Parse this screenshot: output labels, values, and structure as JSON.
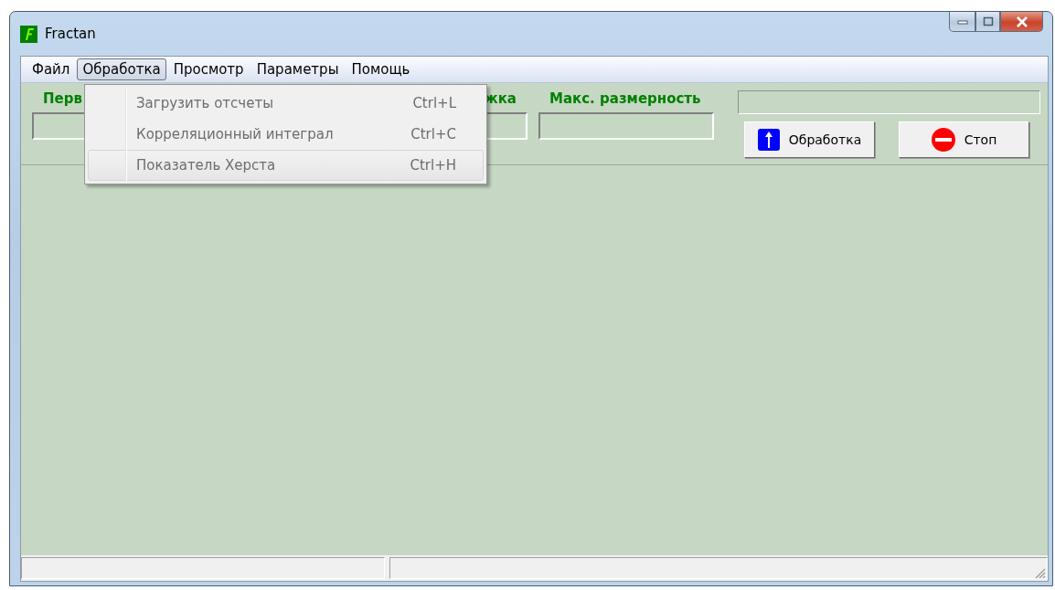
{
  "window": {
    "title": "Fractan"
  },
  "menu_bar": [
    {
      "label": "Файл",
      "selected": false
    },
    {
      "label": "Обработка",
      "selected": true
    },
    {
      "label": "Просмотр",
      "selected": false
    },
    {
      "label": "Параметры",
      "selected": false
    },
    {
      "label": "Помощь",
      "selected": false
    }
  ],
  "open_menu": {
    "items": [
      {
        "label": "Загрузить отсчеты",
        "shortcut": "Ctrl+L",
        "disabled": true,
        "selected": false
      },
      {
        "label": "Корреляционный интеграл",
        "shortcut": "Ctrl+C",
        "disabled": true,
        "selected": false
      },
      {
        "label": "Показатель Херста",
        "shortcut": "Ctrl+H",
        "disabled": true,
        "selected": true
      }
    ]
  },
  "toolbar": {
    "fields": [
      {
        "label": "Перв"
      },
      {
        "label": "жка"
      },
      {
        "label": "Макс. размерность"
      }
    ],
    "buttons": [
      {
        "label": "Обработка",
        "kind": "process"
      },
      {
        "label": "Стоп",
        "kind": "stop"
      }
    ]
  }
}
